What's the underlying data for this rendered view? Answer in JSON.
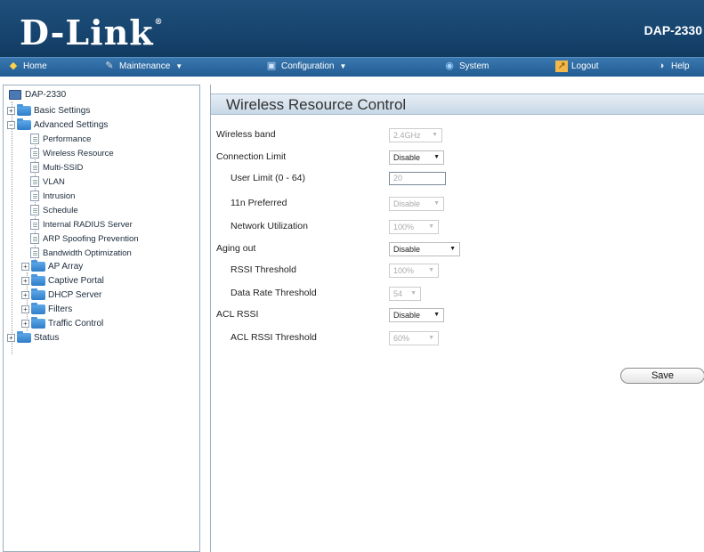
{
  "header": {
    "brand": "D-Link",
    "model": "DAP-2330"
  },
  "menu": [
    {
      "label": "Home",
      "icon": "home-icon"
    },
    {
      "label": "Maintenance",
      "icon": "wrench-icon"
    },
    {
      "label": "Configuration",
      "icon": "save-disk-icon"
    },
    {
      "label": "System",
      "icon": "system-icon"
    },
    {
      "label": "Logout",
      "icon": "logout-icon"
    },
    {
      "label": "Help",
      "icon": "help-icon"
    }
  ],
  "sidebar": {
    "root": "DAP-2330",
    "basic_settings": "Basic Settings",
    "advanced_settings": "Advanced Settings",
    "advanced_items": [
      "Performance",
      "Wireless Resource",
      "Multi-SSID",
      "VLAN",
      "Intrusion",
      "Schedule",
      "Internal RADIUS Server",
      "ARP Spoofing Prevention",
      "Bandwidth Optimization"
    ],
    "folders": [
      "AP Array",
      "Captive Portal",
      "DHCP Server",
      "Filters",
      "Traffic Control"
    ],
    "status": "Status"
  },
  "content": {
    "title": "Wireless Resource Control",
    "fields": {
      "wireless_band": {
        "label": "Wireless band",
        "value": "2.4GHz"
      },
      "connection_limit": {
        "label": "Connection Limit",
        "value": "Disable"
      },
      "user_limit": {
        "label": "User Limit (0 - 64)",
        "value": "20"
      },
      "n11_preferred": {
        "label": "11n Preferred",
        "value": "Disable"
      },
      "network_utilization": {
        "label": "Network Utilization",
        "value": "100%"
      },
      "aging_out": {
        "label": "Aging out",
        "value": "Disable"
      },
      "rssi_threshold": {
        "label": "RSSI Threshold",
        "value": "100%"
      },
      "data_rate_threshold": {
        "label": "Data Rate Threshold",
        "value": "54"
      },
      "acl_rssi": {
        "label": "ACL RSSI",
        "value": "Disable"
      },
      "acl_rssi_threshold": {
        "label": "ACL RSSI Threshold",
        "value": "60%"
      }
    },
    "save_label": "Save"
  }
}
